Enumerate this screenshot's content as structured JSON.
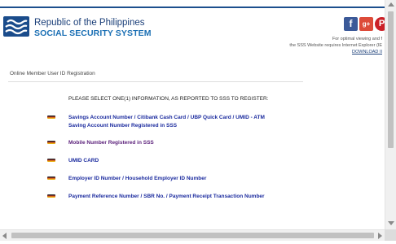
{
  "header": {
    "org_line1": "Republic of the Philippines",
    "org_line2": "SOCIAL SECURITY SYSTEM",
    "logo_icon": "sss-logo-icon",
    "brand_color": "#1a3e78",
    "accent_color": "#1a6fb4",
    "social": [
      {
        "icon": "facebook-icon",
        "glyph": "f",
        "color": "#3b5998"
      },
      {
        "icon": "google-plus-icon",
        "glyph": "g+",
        "color": "#dd4b39"
      },
      {
        "icon": "pinterest-icon",
        "glyph": "P",
        "color": "#cb2027"
      }
    ],
    "note_line1": "For optimal viewing and f",
    "note_line2": "the SSS Website requires Internet Explorer (IE",
    "note_link": "DOWNLOAD II"
  },
  "page": {
    "section_title": "Online Member User ID Registration",
    "instruction": "PLEASE SELECT ONE(1) INFORMATION, AS REPORTED TO SSS TO REGISTER:"
  },
  "options": [
    {
      "label": "Savings Account Number / Citibank Cash Card / UBP Quick Card / UMID - ATM Saving Account Number Registered in SSS",
      "icon": "ph-flag-icon"
    },
    {
      "label": "Mobile Number Registered in SSS",
      "icon": "ph-flag-icon"
    },
    {
      "label": "UMID CARD",
      "icon": "ph-flag-icon"
    },
    {
      "label": "Employer ID Number / Household Employer ID Number",
      "icon": "ph-flag-icon"
    },
    {
      "label": "Payment Reference Number / SBR No. / Payment Receipt Transaction Number",
      "icon": "ph-flag-icon"
    }
  ]
}
